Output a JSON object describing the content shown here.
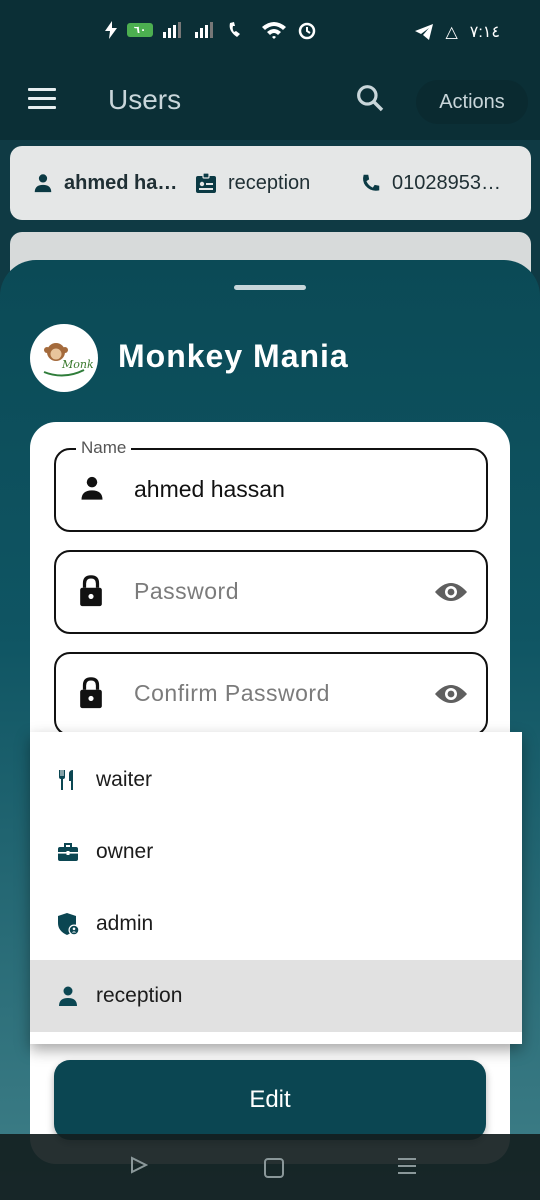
{
  "status_bar": {
    "battery": "٦٠",
    "time": "٧:١٤"
  },
  "app_bar": {
    "title": "Users",
    "actions_label": "Actions"
  },
  "user_card": {
    "name": "ahmed ha…",
    "role": "reception",
    "phone": "01028953…"
  },
  "sheet": {
    "brand_name": "Monkey Mania",
    "logo_text": "Monkey",
    "fields": {
      "name_label": "Name",
      "name_value": "ahmed hassan",
      "password_placeholder": "Password",
      "confirm_placeholder": "Confirm Password"
    },
    "role_options": [
      {
        "label": "waiter",
        "icon": "utensils-icon"
      },
      {
        "label": "owner",
        "icon": "briefcase-icon"
      },
      {
        "label": "admin",
        "icon": "admin-shield-icon"
      },
      {
        "label": "reception",
        "icon": "person-icon",
        "selected": true
      }
    ],
    "edit_label": "Edit"
  },
  "colors": {
    "primary": "#0b4652",
    "sheet_top": "#0b4a56",
    "sheet_bottom": "#3f7f88"
  }
}
